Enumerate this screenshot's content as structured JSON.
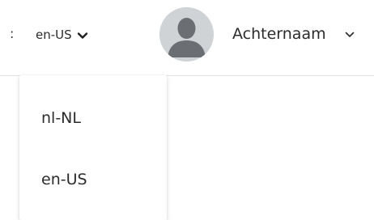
{
  "header": {
    "separator": ":",
    "language_selector": {
      "current": "en-US",
      "icon": "chevron-down-icon"
    },
    "user": {
      "avatar_icon": "user-avatar-icon",
      "name": "Achternaam",
      "menu_icon": "chevron-down-icon"
    }
  },
  "language_dropdown": {
    "options": [
      {
        "label": "nl-NL"
      },
      {
        "label": "en-US"
      }
    ]
  },
  "colors": {
    "text": "#2b2b2b",
    "avatar_bg": "#d0d3d6",
    "avatar_fg": "#6b6f73",
    "divider": "#e2e2e2"
  }
}
